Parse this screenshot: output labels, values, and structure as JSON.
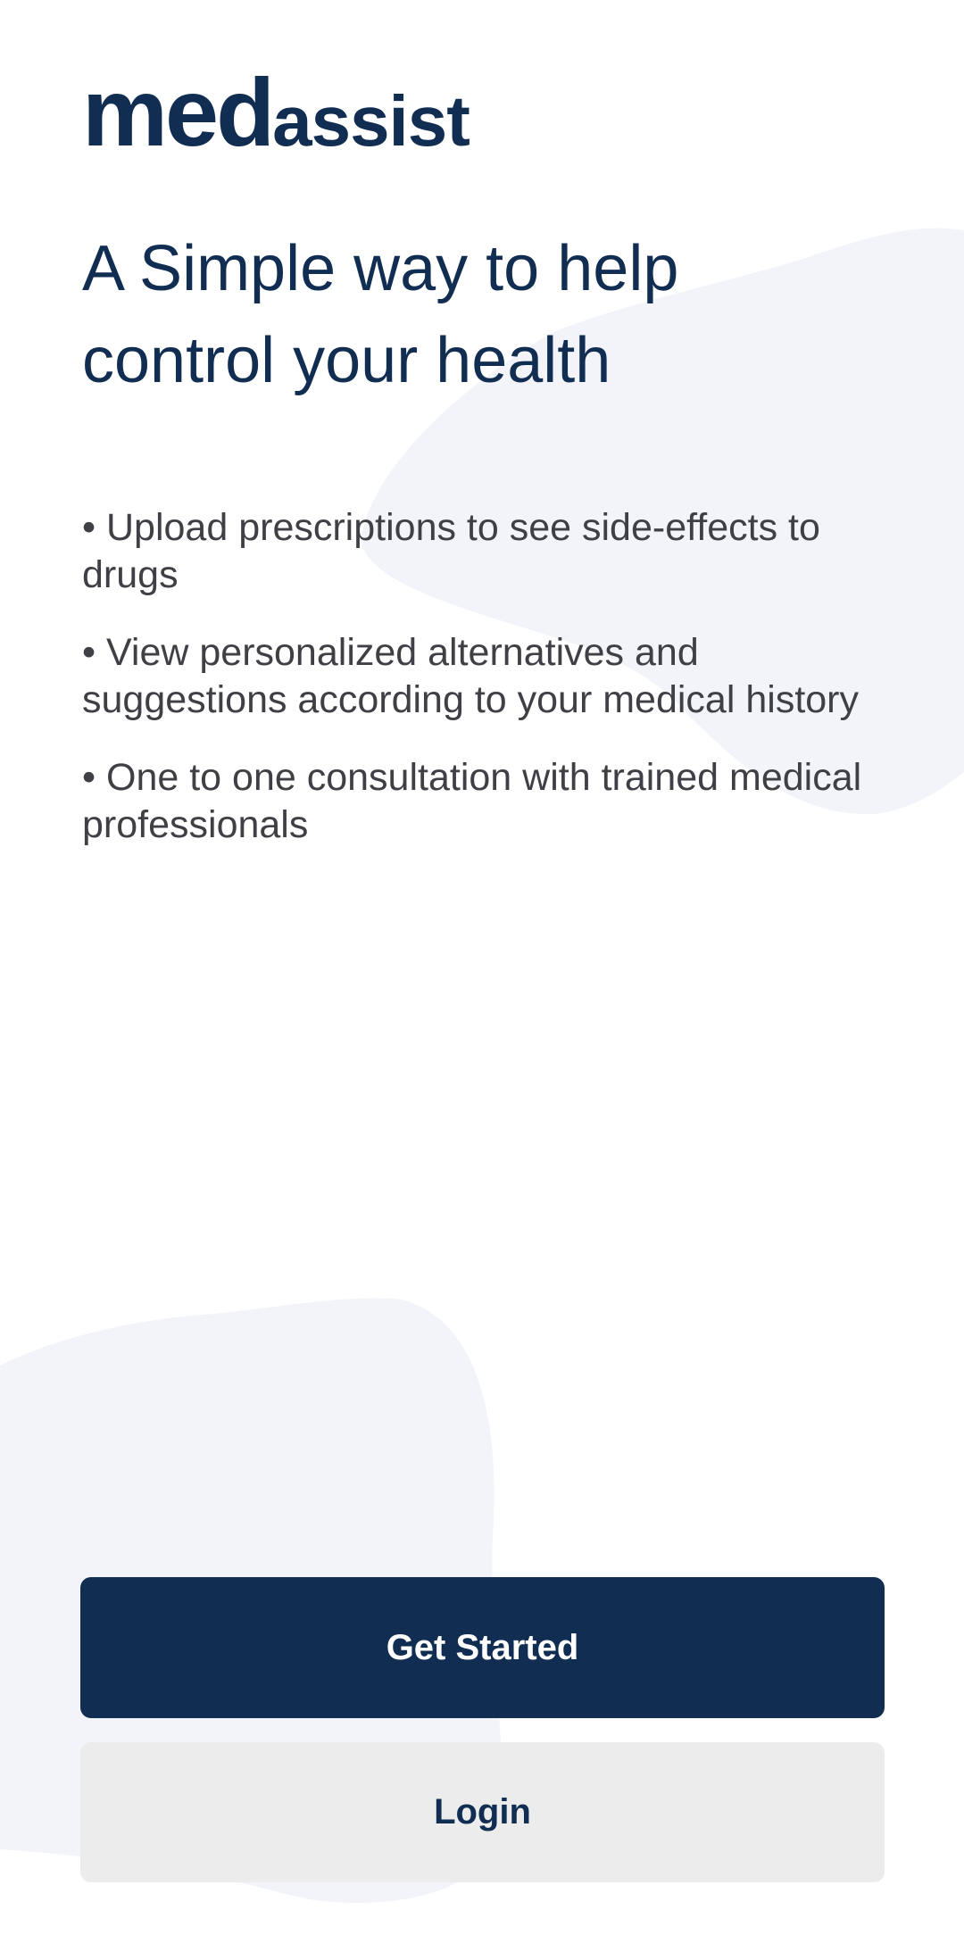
{
  "app": {
    "logo_bold": "med",
    "logo_rest": "assist"
  },
  "hero": {
    "headline": "A Simple way to help control your health"
  },
  "features": [
    "• Upload prescriptions to see side-effects to drugs",
    "• View personalized alternatives and suggestions according to your medical history",
    "• One to one consultation with trained medical professionals"
  ],
  "actions": {
    "get_started_label": "Get Started",
    "login_label": "Login"
  },
  "colors": {
    "brand_navy": "#112d52",
    "blob_tint": "#f3f4fa",
    "secondary_button": "#ececec"
  }
}
